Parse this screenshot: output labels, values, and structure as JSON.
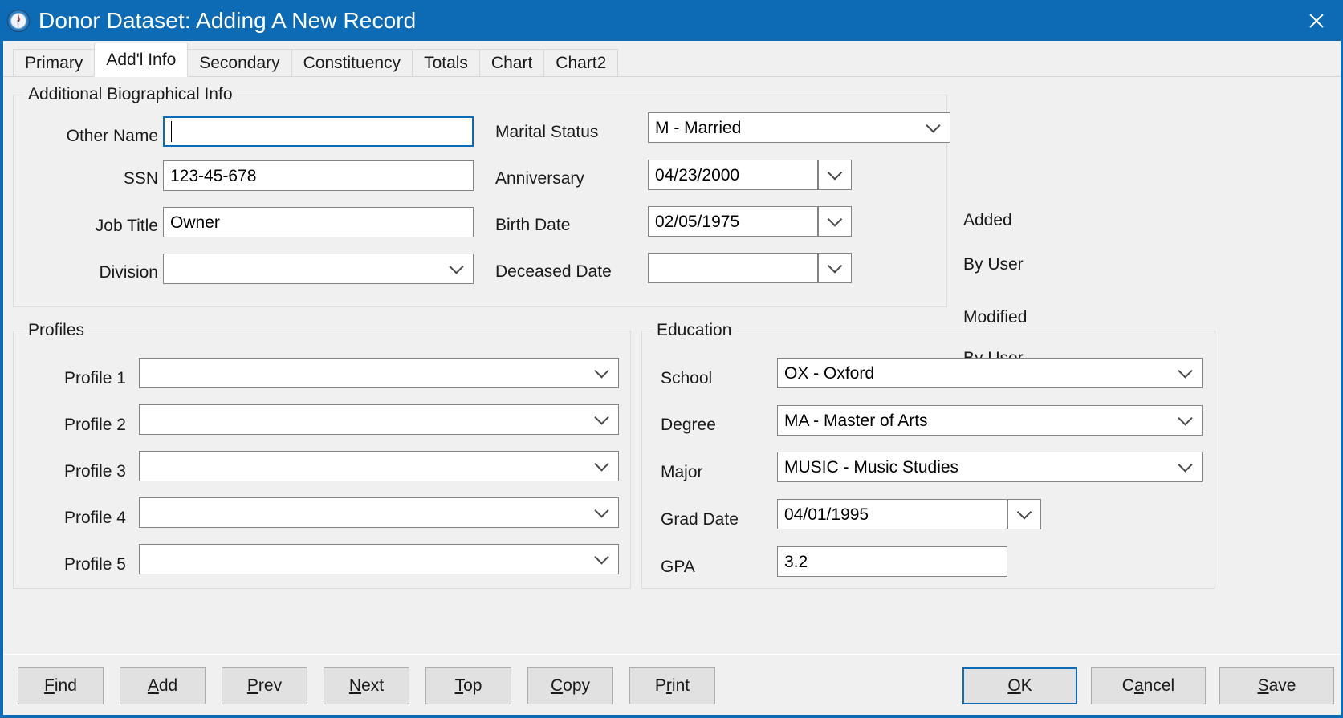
{
  "window": {
    "title": "Donor Dataset: Adding A New Record",
    "icon": "compass-icon",
    "close_label": "✕",
    "accent_color": "#0d6ab4",
    "surface_color": "#f0f0f0"
  },
  "tabs": [
    {
      "label": "Primary",
      "active": false
    },
    {
      "label": "Add'l Info",
      "active": true
    },
    {
      "label": "Secondary",
      "active": false
    },
    {
      "label": "Constituency",
      "active": false
    },
    {
      "label": "Totals",
      "active": false
    },
    {
      "label": "Chart",
      "active": false
    },
    {
      "label": "Chart2",
      "active": false
    }
  ],
  "bio": {
    "legend": "Additional Biographical Info",
    "other_name": {
      "label": "Other Name",
      "value": "",
      "type": "text",
      "focused": true
    },
    "ssn": {
      "label": "SSN",
      "value": "123-45-678",
      "type": "text"
    },
    "job_title": {
      "label": "Job Title",
      "value": "Owner",
      "type": "text"
    },
    "division": {
      "label": "Division",
      "value": "",
      "type": "combo"
    },
    "marital_status": {
      "label": "Marital Status",
      "value": "M - Married",
      "type": "combo"
    },
    "anniversary": {
      "label": "Anniversary",
      "value": "04/23/2000",
      "type": "date"
    },
    "birth_date": {
      "label": "Birth Date",
      "value": "02/05/1975",
      "type": "date"
    },
    "deceased_date": {
      "label": "Deceased Date",
      "value": "",
      "type": "date"
    }
  },
  "audit": {
    "added_label": "Added",
    "added_value": "",
    "added_by_label": "By User",
    "added_by_value": "",
    "modified_label": "Modified",
    "modified_value": "",
    "modified_by_label": "By User",
    "modified_by_value": ""
  },
  "profiles": {
    "legend": "Profiles",
    "rows": [
      {
        "label": "Profile 1",
        "value": ""
      },
      {
        "label": "Profile 2",
        "value": ""
      },
      {
        "label": "Profile 3",
        "value": ""
      },
      {
        "label": "Profile 4",
        "value": ""
      },
      {
        "label": "Profile 5",
        "value": ""
      }
    ]
  },
  "education": {
    "legend": "Education",
    "school": {
      "label": "School",
      "value": "OX - Oxford",
      "type": "combo"
    },
    "degree": {
      "label": "Degree",
      "value": "MA - Master of Arts",
      "type": "combo"
    },
    "major": {
      "label": "Major",
      "value": "MUSIC - Music Studies",
      "type": "combo"
    },
    "grad_date": {
      "label": "Grad Date",
      "value": "04/01/1995",
      "type": "date"
    },
    "gpa": {
      "label": "GPA",
      "value": "3.2",
      "type": "text"
    }
  },
  "buttons": {
    "left": [
      {
        "label": "Find",
        "accel": "F"
      },
      {
        "label": "Add",
        "accel": "A"
      },
      {
        "label": "Prev",
        "accel": "P"
      },
      {
        "label": "Next",
        "accel": "N"
      },
      {
        "label": "Top",
        "accel": "T"
      },
      {
        "label": "Copy",
        "accel": "C"
      },
      {
        "label": "Print",
        "accel": "r"
      }
    ],
    "right": [
      {
        "label": "OK",
        "accel": "O",
        "default": true
      },
      {
        "label": "Cancel",
        "accel": "a",
        "default": false
      },
      {
        "label": "Save",
        "accel": "S",
        "default": false
      }
    ]
  }
}
